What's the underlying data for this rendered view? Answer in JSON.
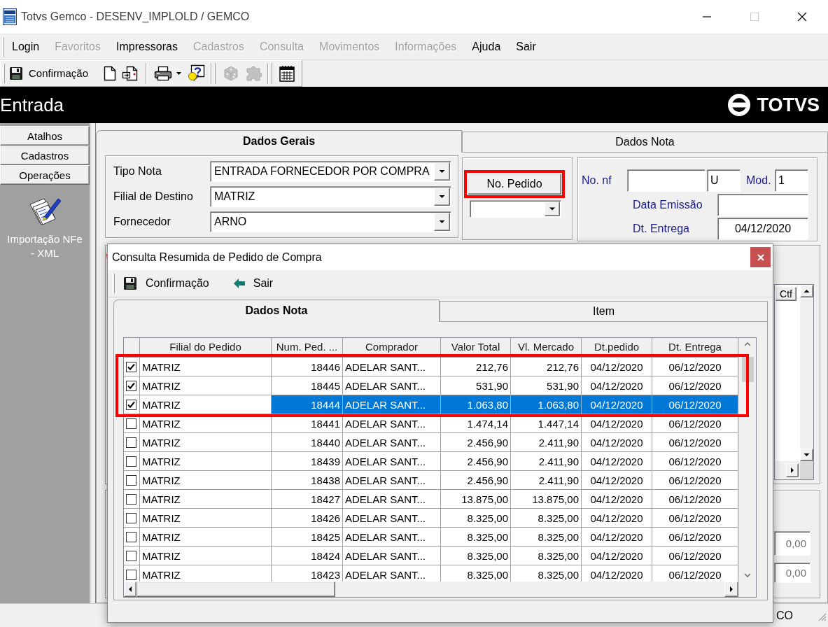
{
  "window": {
    "title": "Totvs Gemco - DESENV_IMPLOLD / GEMCO"
  },
  "menu": [
    {
      "label": "Login",
      "disabled": false
    },
    {
      "label": "Favoritos",
      "disabled": true
    },
    {
      "label": "Impressoras",
      "disabled": false
    },
    {
      "label": "Cadastros",
      "disabled": true
    },
    {
      "label": "Consulta",
      "disabled": true
    },
    {
      "label": "Movimentos",
      "disabled": true
    },
    {
      "label": "Informações",
      "disabled": true
    },
    {
      "label": "Ajuda",
      "disabled": false
    },
    {
      "label": "Sair",
      "disabled": false
    }
  ],
  "toolbar": [
    {
      "label": "Confirmação",
      "disabled": false
    },
    {
      "disabled": false
    },
    {
      "disabled": false
    },
    {
      "disabled": false
    },
    {
      "disabled": false
    },
    {
      "disabled": true
    },
    {
      "disabled": true
    },
    {
      "disabled": false
    }
  ],
  "header": {
    "title": "Entrada",
    "logo": "TOTVS"
  },
  "sidebar": {
    "sections": [
      {
        "label": "Atalhos"
      },
      {
        "label": "Cadastros"
      },
      {
        "label": "Operações"
      }
    ],
    "items": [
      {
        "label": "Importação NFe - XML"
      }
    ]
  },
  "main": {
    "tabs": [
      {
        "label": "Dados Gerais",
        "selected": true
      },
      {
        "label": "Dados Nota",
        "selected": false
      }
    ],
    "fields": [
      {
        "label": "Tipo Nota",
        "value": "ENTRADA FORNECEDOR POR COMPRA"
      },
      {
        "label": "Filial de Destino",
        "value": "MATRIZ"
      },
      {
        "label": "Fornecedor",
        "value": "ARNO"
      }
    ],
    "pedido": {
      "button": "No. Pedido",
      "highlighted": true
    },
    "nota": {
      "no_nf_label": "No. nf",
      "serie": "U",
      "mod_label": "Mod.",
      "mod": "1",
      "emissao_label": "Data Emissão",
      "entrega_label": "Dt. Entrega",
      "entrega": "04/12/2020"
    },
    "grid_column": "Ctf",
    "totals": [
      "0,00",
      "0,00"
    ]
  },
  "status_bar": {
    "text": "CO"
  },
  "dialog": {
    "title": "Consulta Resumida de Pedido de Compra",
    "toolbar": [
      {
        "label": "Confirmação"
      },
      {
        "label": "Sair"
      }
    ],
    "tabs": [
      {
        "label": "Dados Nota",
        "selected": true
      },
      {
        "label": "Item",
        "selected": false
      }
    ],
    "grid": {
      "highlight_checked": true,
      "columns": [
        "Filial do Pedido",
        "Num. Ped. ...",
        "Comprador",
        "Valor Total",
        "Vl. Mercado",
        "Dt.pedido",
        "Dt. Entrega"
      ],
      "rows": [
        {
          "checked": true,
          "selected": false,
          "cells": [
            "MATRIZ",
            "18446",
            "ADELAR SANT...",
            "212,76",
            "212,76",
            "04/12/2020",
            "06/12/2020"
          ]
        },
        {
          "checked": true,
          "selected": false,
          "cells": [
            "MATRIZ",
            "18445",
            "ADELAR SANT...",
            "531,90",
            "531,90",
            "04/12/2020",
            "06/12/2020"
          ]
        },
        {
          "checked": true,
          "selected": true,
          "cells": [
            "MATRIZ",
            "18444",
            "ADELAR SANT...",
            "1.063,80",
            "1.063,80",
            "04/12/2020",
            "06/12/2020"
          ]
        },
        {
          "checked": false,
          "selected": false,
          "cells": [
            "MATRIZ",
            "18441",
            "ADELAR SANT...",
            "1.474,14",
            "1.447,14",
            "04/12/2020",
            "06/12/2020"
          ]
        },
        {
          "checked": false,
          "selected": false,
          "cells": [
            "MATRIZ",
            "18440",
            "ADELAR SANT...",
            "2.456,90",
            "2.411,90",
            "04/12/2020",
            "06/12/2020"
          ]
        },
        {
          "checked": false,
          "selected": false,
          "cells": [
            "MATRIZ",
            "18439",
            "ADELAR SANT...",
            "2.456,90",
            "2.411,90",
            "04/12/2020",
            "06/12/2020"
          ]
        },
        {
          "checked": false,
          "selected": false,
          "cells": [
            "MATRIZ",
            "18438",
            "ADELAR SANT...",
            "2.456,90",
            "2.411,90",
            "04/12/2020",
            "06/12/2020"
          ]
        },
        {
          "checked": false,
          "selected": false,
          "cells": [
            "MATRIZ",
            "18427",
            "ADELAR SANT...",
            "13.875,00",
            "13.875,00",
            "04/12/2020",
            "06/12/2020"
          ]
        },
        {
          "checked": false,
          "selected": false,
          "cells": [
            "MATRIZ",
            "18426",
            "ADELAR SANT...",
            "8.325,00",
            "8.325,00",
            "04/12/2020",
            "06/12/2020"
          ]
        },
        {
          "checked": false,
          "selected": false,
          "cells": [
            "MATRIZ",
            "18425",
            "ADELAR SANT...",
            "8.325,00",
            "8.325,00",
            "04/12/2020",
            "06/12/2020"
          ]
        },
        {
          "checked": false,
          "selected": false,
          "cells": [
            "MATRIZ",
            "18424",
            "ADELAR SANT...",
            "8.325,00",
            "8.325,00",
            "04/12/2020",
            "06/12/2020"
          ]
        },
        {
          "checked": false,
          "selected": false,
          "cells": [
            "MATRIZ",
            "18423",
            "ADELAR SANT...",
            "8.325,00",
            "8.325,00",
            "04/12/2020",
            "06/12/2020"
          ]
        }
      ]
    }
  }
}
